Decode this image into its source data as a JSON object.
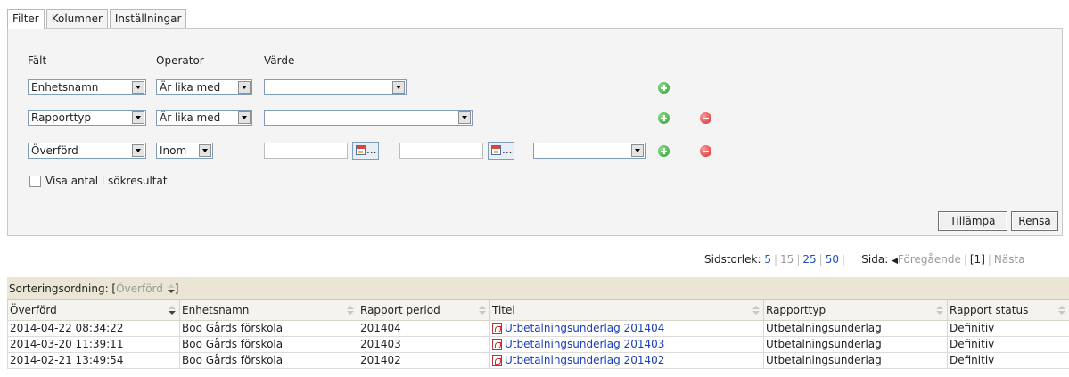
{
  "tabs": [
    "Filter",
    "Kolumner",
    "Inställningar"
  ],
  "filter": {
    "headers": {
      "field": "Fält",
      "operator": "Operator",
      "value": "Värde"
    },
    "rows": [
      {
        "field": "Enhetsnamn",
        "operator": "Är lika med"
      },
      {
        "field": "Rapporttyp",
        "operator": "Är lika med"
      },
      {
        "field": "Överförd",
        "operator": "Inom"
      }
    ],
    "calendar_button_text": "...",
    "show_count_label": "Visa antal i sökresultat",
    "apply_label": "Tillämpa",
    "clear_label": "Rensa"
  },
  "paging": {
    "page_size_label": "Sidstorlek:",
    "page_sizes": [
      "5",
      "15",
      "25",
      "50"
    ],
    "page_label": "Sida:",
    "prev_label": "Föregående",
    "current_page": "[1]",
    "next_label": "Nästa"
  },
  "sort": {
    "label": "Sorteringsordning:",
    "field": "Överförd"
  },
  "table": {
    "columns": [
      "Överförd",
      "Enhetsnamn",
      "Rapport period",
      "Titel",
      "Rapporttyp",
      "Rapport status"
    ],
    "rows": [
      [
        "2014-04-22 08:34:22",
        "Boo Gårds förskola",
        "201404",
        "Utbetalningsunderlag 201404",
        "Utbetalningsunderlag",
        "Definitiv"
      ],
      [
        "2014-03-20 11:39:11",
        "Boo Gårds förskola",
        "201403",
        "Utbetalningsunderlag 201403",
        "Utbetalningsunderlag",
        "Definitiv"
      ],
      [
        "2014-02-21 13:49:54",
        "Boo Gårds förskola",
        "201402",
        "Utbetalningsunderlag 201402",
        "Utbetalningsunderlag",
        "Definitiv"
      ]
    ]
  },
  "colors": {
    "link": "#1a3fb5",
    "sortbar_bg": "#eae5d5",
    "panel_bg": "#f4f4f4",
    "add_icon": "#2e9a2e",
    "remove_icon": "#d42828"
  }
}
